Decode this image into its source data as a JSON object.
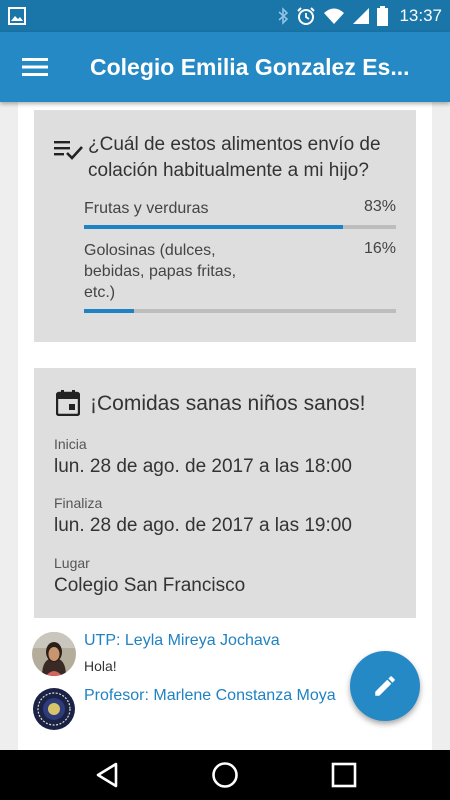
{
  "status_bar": {
    "time": "13:37",
    "icons": [
      "image-notification-icon",
      "bluetooth-icon",
      "alarm-icon",
      "wifi-icon",
      "signal-icon",
      "battery-icon"
    ]
  },
  "app_bar": {
    "title": "Colegio Emilia Gonzalez Es...",
    "menu_icon": "menu-icon",
    "color": "#2589c6"
  },
  "poll": {
    "icon": "poll-list-icon",
    "question": "¿Cuál de estos alimentos envío de colación habitualmente a mi hijo?",
    "options": [
      {
        "label": "Frutas y verduras",
        "percent_text": "83%",
        "percent": 83
      },
      {
        "label": "Golosinas (dulces, bebidas, papas fritas, etc.)",
        "percent_text": "16%",
        "percent": 16
      }
    ]
  },
  "event": {
    "icon": "calendar-icon",
    "title": "¡Comidas sanas niños sanos!",
    "start_label": "Inicia",
    "start_value": "lun. 28 de ago. de 2017 a las 18:00",
    "end_label": "Finaliza",
    "end_value": "lun. 28 de ago. de 2017 a las 19:00",
    "place_label": "Lugar",
    "place_value": "Colegio San Francisco"
  },
  "comments": [
    {
      "author": "UTP: Leyla Mireya Jochava",
      "text": "Hola!"
    },
    {
      "author": "Profesor: Marlene Constanza Moya",
      "text": ""
    }
  ],
  "fab": {
    "icon": "edit-pencil-icon"
  },
  "nav_bar": {
    "icons": [
      "back-icon",
      "home-icon",
      "recents-icon"
    ]
  },
  "colors": {
    "accent": "#1f82c3",
    "card_bg": "#dedede",
    "status_bar": "#1a75a8"
  }
}
